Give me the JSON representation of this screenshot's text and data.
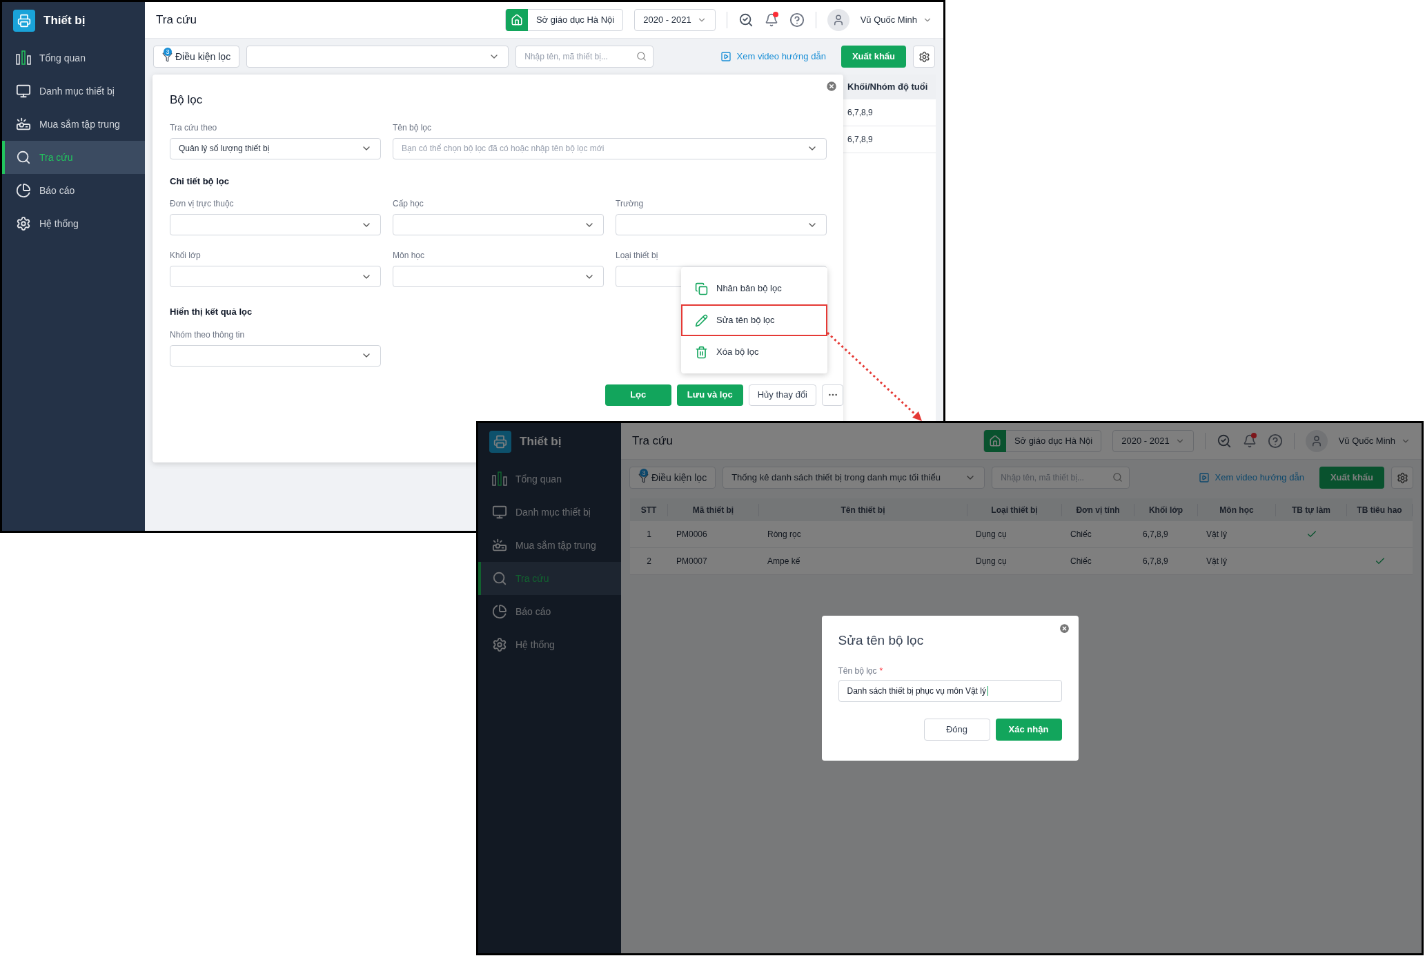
{
  "windows": [
    {
      "kind": "filter_panel",
      "sidebar": {
        "title": "Thiết bị",
        "items": [
          {
            "label": "Tổng quan",
            "selected": false
          },
          {
            "label": "Danh mục thiết bị",
            "selected": false
          },
          {
            "label": "Mua sắm tập trung",
            "selected": false
          },
          {
            "label": "Tra cứu",
            "selected": true
          },
          {
            "label": "Báo cáo",
            "selected": false
          },
          {
            "label": "Hệ thống",
            "selected": false
          }
        ]
      },
      "header": {
        "title": "Tra cứu",
        "org": "Sở giáo dục Hà Nội",
        "year": "2020 - 2021",
        "user": "Vũ Quốc Minh"
      },
      "toolbar": {
        "filter_button": "Điều kiện lọc",
        "filter_count": "3",
        "search_placeholder": "Nhập tên, mã thiết bị...",
        "video_link": "Xem video hướng dẫn",
        "export": "Xuất khẩu"
      },
      "background_table": {
        "column": "Khối/Nhóm độ tuổi",
        "cells": [
          "6,7,8,9",
          "6,7,8,9"
        ]
      },
      "filter_panel": {
        "title": "Bộ lọc",
        "top_fields": [
          {
            "label": "Tra cứu theo",
            "value": "Quản lý số lượng thiết bị"
          },
          {
            "label": "Tên bộ lọc",
            "placeholder": "Bạn có thể chọn bộ lọc đã có hoặc nhập tên bộ lọc mới"
          }
        ],
        "detail_title": "Chi tiết bộ lọc",
        "detail_fields": [
          {
            "label": "Đơn vị trực thuộc"
          },
          {
            "label": "Cấp học"
          },
          {
            "label": "Trường"
          },
          {
            "label": "Khối lớp"
          },
          {
            "label": "Môn học"
          },
          {
            "label": "Loại thiết bị"
          }
        ],
        "result_title": "Hiển thị kết quả lọc",
        "result_fields": [
          {
            "label": "Nhóm theo thông tin"
          }
        ],
        "buttons": [
          "Lọc",
          "Lưu và lọc",
          "Hủy thay đổi"
        ],
        "menu": [
          {
            "label": "Nhân bản bộ lọc",
            "highlighted": false
          },
          {
            "label": "Sửa tên bộ lọc",
            "highlighted": true
          },
          {
            "label": "Xóa bộ lọc",
            "highlighted": false
          }
        ]
      }
    },
    {
      "kind": "rename_dialog",
      "sidebar": {
        "title": "Thiết bị",
        "items": [
          {
            "label": "Tổng quan",
            "selected": false
          },
          {
            "label": "Danh mục thiết bị",
            "selected": false
          },
          {
            "label": "Mua sắm tập trung",
            "selected": false
          },
          {
            "label": "Tra cứu",
            "selected": true
          },
          {
            "label": "Báo cáo",
            "selected": false
          },
          {
            "label": "Hệ thống",
            "selected": false
          }
        ]
      },
      "header": {
        "title": "Tra cứu",
        "org": "Sở giáo dục Hà Nội",
        "year": "2020 - 2021",
        "user": "Vũ Quốc Minh"
      },
      "toolbar": {
        "filter_button": "Điều kiện lọc",
        "filter_count": "3",
        "filter_value": "Thống kê danh sách thiết bị trong danh mục tối thiểu",
        "search_placeholder": "Nhập tên, mã thiết bị...",
        "video_link": "Xem video hướng dẫn",
        "export": "Xuất khẩu"
      },
      "table": {
        "columns": [
          "STT",
          "Mã thiết bị",
          "Tên thiết bị",
          "Loại thiết bị",
          "Đơn vị tính",
          "Khối lớp",
          "Môn học",
          "TB tự làm",
          "TB tiêu hao"
        ],
        "rows": [
          {
            "cells": [
              "1",
              "PM0006",
              "Ròng rọc",
              "Dụng cụ",
              "Chiếc",
              "6,7,8,9",
              "Vật lý"
            ],
            "self_made": true,
            "consumable": false
          },
          {
            "cells": [
              "2",
              "PM0007",
              "Ampe kế",
              "Dụng cụ",
              "Chiếc",
              "6,7,8,9",
              "Vật lý"
            ],
            "self_made": false,
            "consumable": true
          }
        ]
      },
      "dialog": {
        "title": "Sửa tên bộ lọc",
        "label": "Tên bộ lọc",
        "required": "*",
        "value": "Danh sách thiết bị phục vụ môn Vật lý",
        "buttons": [
          "Đóng",
          "Xác nhận"
        ]
      }
    }
  ]
}
